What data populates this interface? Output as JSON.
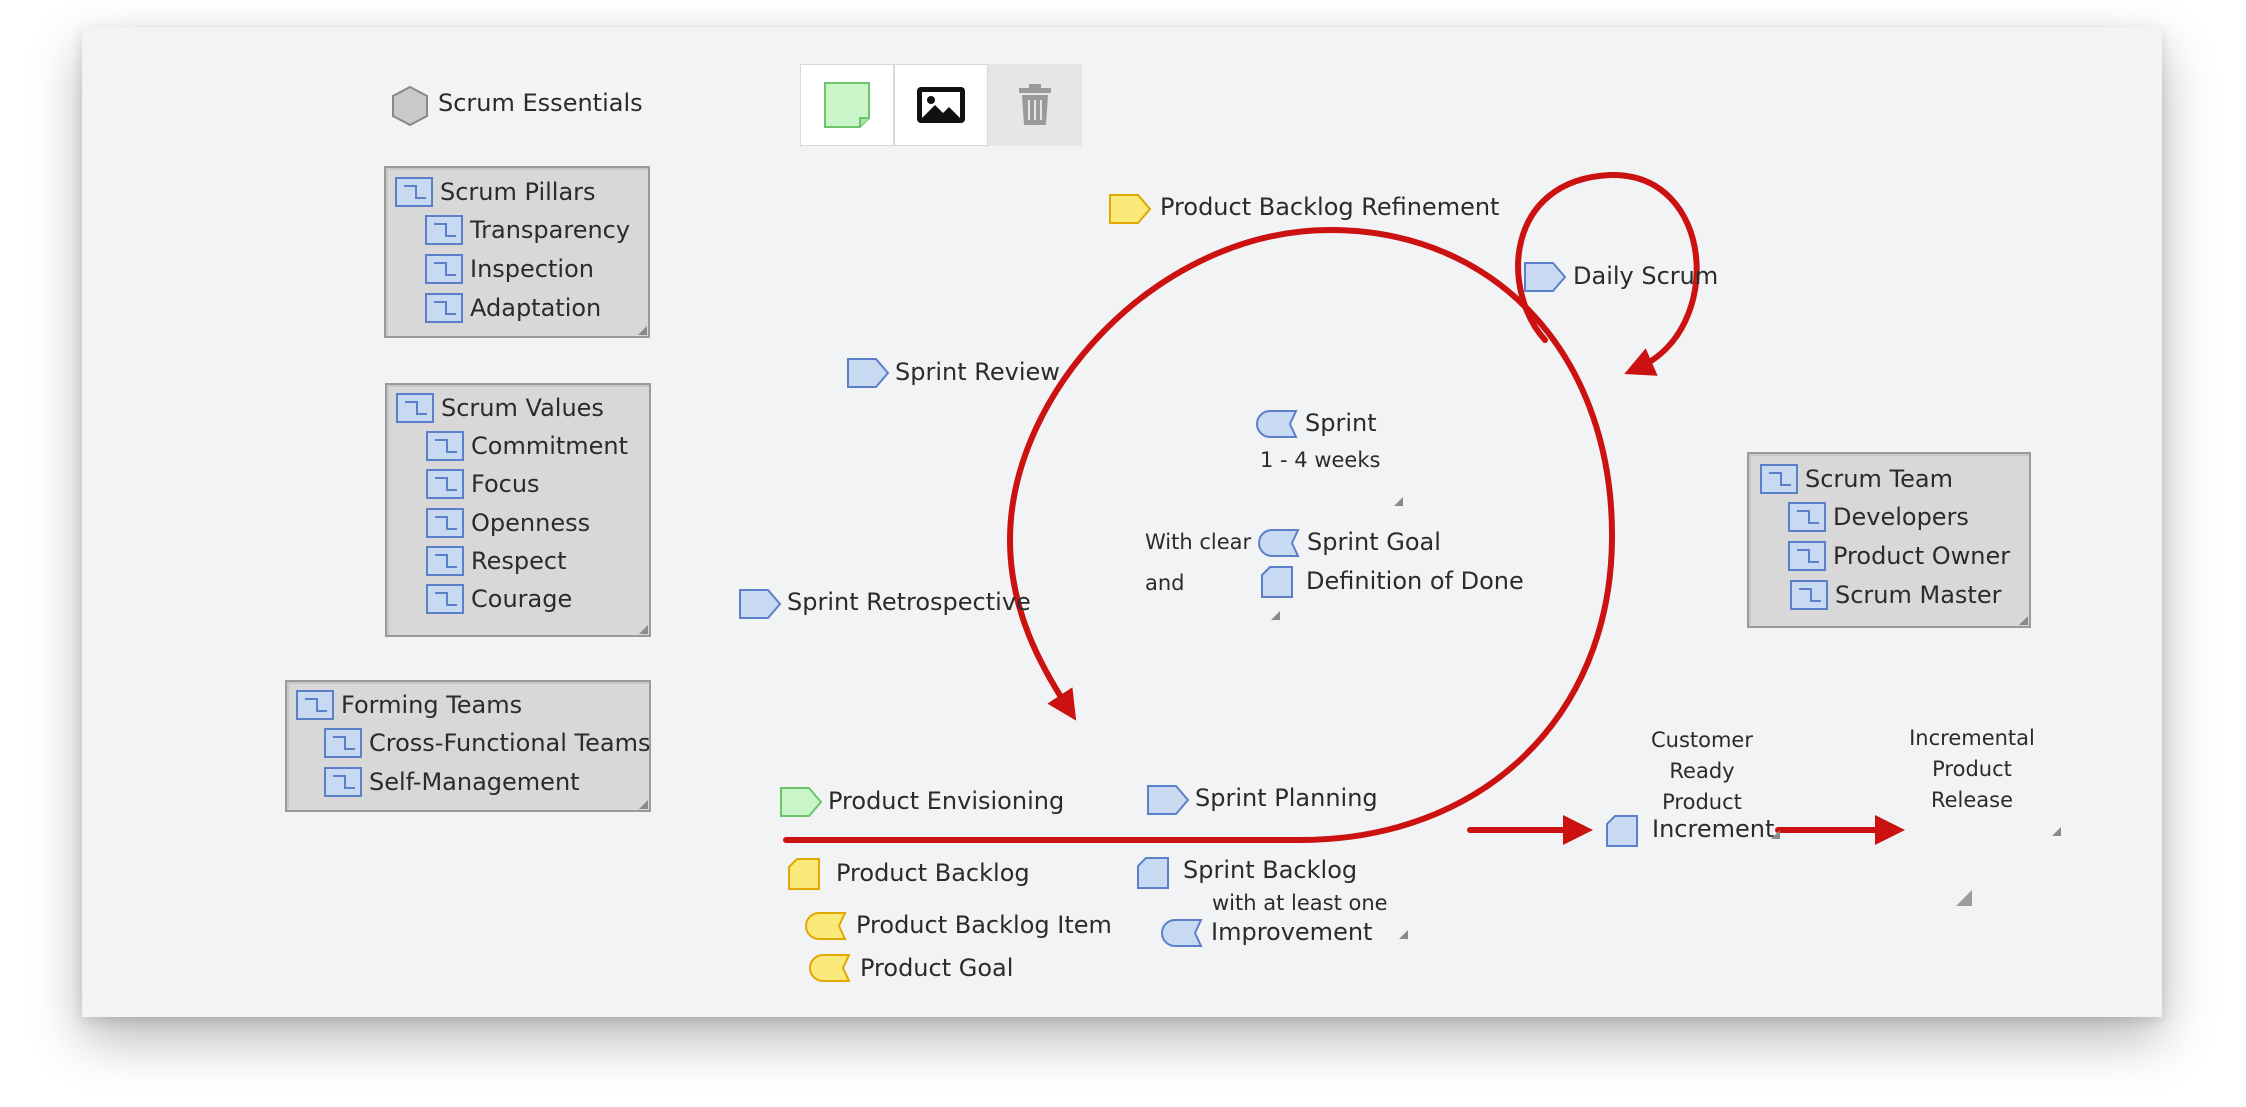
{
  "title": "Scrum Essentials",
  "toolbar": {
    "note_icon": "sticky-note-icon",
    "image_icon": "image-icon",
    "delete_icon": "trash-icon"
  },
  "groups": {
    "pillars": {
      "title": "Scrum Pillars",
      "items": [
        "Transparency",
        "Inspection",
        "Adaptation"
      ]
    },
    "values": {
      "title": "Scrum Values",
      "items": [
        "Commitment",
        "Focus",
        "Openness",
        "Respect",
        "Courage"
      ]
    },
    "forming": {
      "title": "Forming Teams",
      "items": [
        "Cross-Functional Teams",
        "Self-Management"
      ]
    },
    "team": {
      "title": "Scrum Team",
      "items": [
        "Developers",
        "Product Owner",
        "Scrum Master"
      ]
    }
  },
  "events": {
    "refinement": "Product Backlog Refinement",
    "daily": "Daily Scrum",
    "review": "Sprint Review",
    "retrospective": "Sprint Retrospective",
    "envisioning": "Product Envisioning",
    "planning": "Sprint Planning"
  },
  "sprint": {
    "name": "Sprint",
    "duration": "1 - 4 weeks",
    "with_clear": "With clear",
    "and": "and",
    "goal": "Sprint Goal",
    "dod": "Definition of Done"
  },
  "artifacts": {
    "product_backlog": "Product Backlog",
    "pbi": "Product Backlog Item",
    "product_goal": "Product Goal",
    "sprint_backlog": "Sprint Backlog",
    "with_one": "with at least one",
    "improvement": "Improvement"
  },
  "increment": {
    "l1": "Customer",
    "l2": "Ready",
    "l3": "Product",
    "l4": "Increment"
  },
  "release": {
    "l1": "Incremental",
    "l2": "Product",
    "l3": "Release"
  },
  "colors": {
    "canvas": "#f2f3f5",
    "flow": "#cc1111",
    "blue_fill": "#c8d9f2",
    "blue_stroke": "#5b7fc8",
    "yellow_fill": "#fbe97a",
    "yellow_stroke": "#e0a800",
    "green_fill": "#c9f5c9",
    "green_stroke": "#6cc56c",
    "box_fill": "#d8d8d8"
  }
}
